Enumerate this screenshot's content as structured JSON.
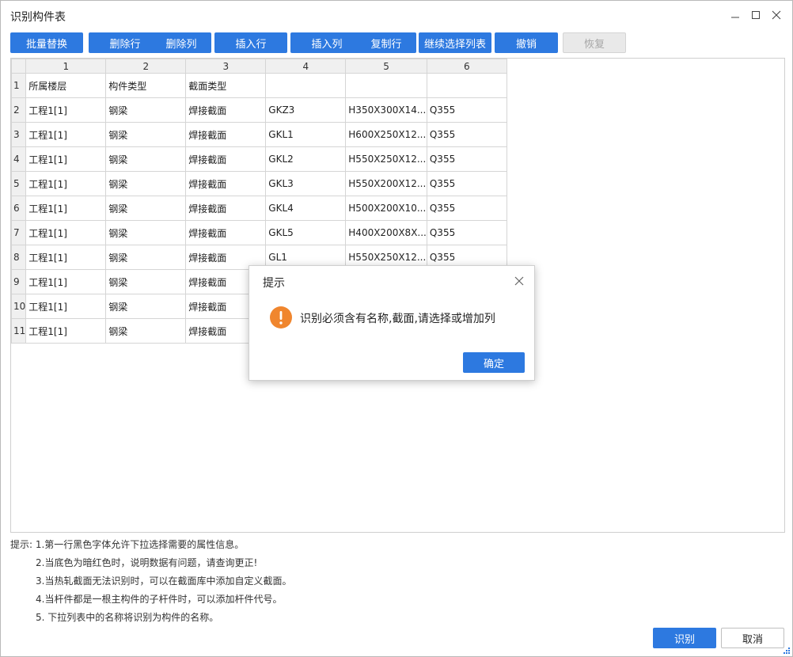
{
  "window": {
    "title": "识别构件表"
  },
  "toolbar": {
    "batch_replace": "批量替换",
    "delete_row": "删除行",
    "delete_col": "删除列",
    "insert_row": "插入行",
    "insert_col": "插入列",
    "copy_row": "复制行",
    "continue_select": "继续选择列表",
    "undo": "撤销",
    "redo": "恢复"
  },
  "grid": {
    "columns": [
      "1",
      "2",
      "3",
      "4",
      "5",
      "6"
    ],
    "rows": [
      {
        "num": "1",
        "cells": [
          "所属楼层",
          "构件类型",
          "截面类型",
          "",
          "",
          ""
        ]
      },
      {
        "num": "2",
        "cells": [
          "工程1[1]",
          "钢梁",
          "焊接截面",
          "GKZ3",
          "H350X300X14...",
          "Q355"
        ]
      },
      {
        "num": "3",
        "cells": [
          "工程1[1]",
          "钢梁",
          "焊接截面",
          "GKL1",
          "H600X250X12...",
          "Q355"
        ]
      },
      {
        "num": "4",
        "cells": [
          "工程1[1]",
          "钢梁",
          "焊接截面",
          "GKL2",
          "H550X250X12...",
          "Q355"
        ]
      },
      {
        "num": "5",
        "cells": [
          "工程1[1]",
          "钢梁",
          "焊接截面",
          "GKL3",
          "H550X200X12...",
          "Q355"
        ]
      },
      {
        "num": "6",
        "cells": [
          "工程1[1]",
          "钢梁",
          "焊接截面",
          "GKL4",
          "H500X200X10...",
          "Q355"
        ]
      },
      {
        "num": "7",
        "cells": [
          "工程1[1]",
          "钢梁",
          "焊接截面",
          "GKL5",
          "H400X200X8X...",
          "Q355"
        ]
      },
      {
        "num": "8",
        "cells": [
          "工程1[1]",
          "钢梁",
          "焊接截面",
          "GL1",
          "H550X250X12...",
          "Q355"
        ]
      },
      {
        "num": "9",
        "cells": [
          "工程1[1]",
          "钢梁",
          "焊接截面",
          "",
          "",
          ""
        ]
      },
      {
        "num": "10",
        "cells": [
          "工程1[1]",
          "钢梁",
          "焊接截面",
          "",
          "",
          ""
        ]
      },
      {
        "num": "11",
        "cells": [
          "工程1[1]",
          "钢梁",
          "焊接截面",
          "",
          "",
          ""
        ]
      }
    ]
  },
  "hints": {
    "line1": "提示: 1.第一行黑色字体允许下拉选择需要的属性信息。",
    "line2": "2.当底色为暗红色时，说明数据有问题，请查询更正!",
    "line3": "3.当热轧截面无法识别时，可以在截面库中添加自定义截面。",
    "line4": "4.当杆件都是一根主构件的子杆件时，可以添加杆件代号。",
    "line5": "5. 下拉列表中的名称将识别为构件的名称。"
  },
  "footer": {
    "identify": "识别",
    "cancel": "取消"
  },
  "dialog": {
    "title": "提示",
    "message": "识别必须含有名称,截面,请选择或增加列",
    "ok": "确定",
    "icon": "warning-icon"
  },
  "colors": {
    "primary": "#2d79e0",
    "warning": "#f0862e"
  }
}
